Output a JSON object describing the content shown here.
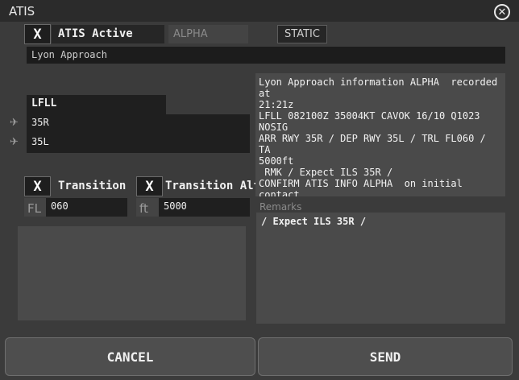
{
  "window": {
    "title": "ATIS"
  },
  "icons": {
    "close": "close-icon",
    "runway": "runway-plane-icon"
  },
  "atis": {
    "active_check": "X",
    "active_label": "ATIS Active",
    "letter_value": "ALPHA",
    "mode_badge": "STATIC",
    "station_name": "Lyon Approach"
  },
  "airport": {
    "icao": "LFLL"
  },
  "runways": {
    "arrival": "35R",
    "departure": "35L"
  },
  "transition_level": {
    "check": "X",
    "label": "Transition",
    "unit": "FL",
    "value": "060"
  },
  "transition_altitude": {
    "check": "X",
    "label": "Transition Alti",
    "unit": "ft",
    "value": "5000"
  },
  "preview_text": "Lyon Approach information ALPHA  recorded at\n21:21z\nLFLL 082100Z 35004KT CAVOK 16/10 Q1023 NOSIG\nARR RWY 35R / DEP RWY 35L / TRL FL060 / TA\n5000ft\n RMK / Expect ILS 35R /\nCONFIRM ATIS INFO ALPHA  on initial contact",
  "remarks": {
    "label": "Remarks",
    "value": "/ Expect ILS 35R /"
  },
  "buttons": {
    "cancel": "CANCEL",
    "send": "SEND"
  }
}
